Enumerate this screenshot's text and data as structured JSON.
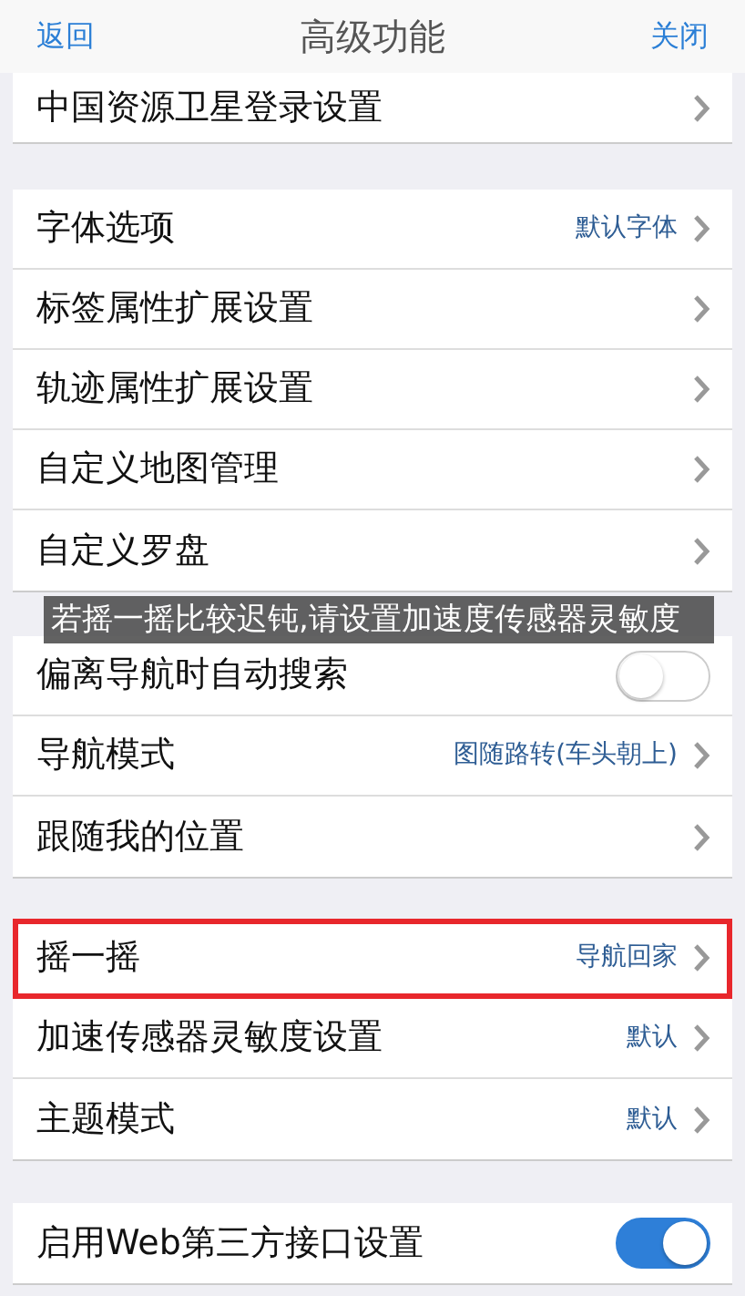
{
  "nav": {
    "back": "返回",
    "title": "高级功能",
    "close": "关闭"
  },
  "groups": [
    {
      "rows": [
        {
          "kind": "link",
          "label": "中国资源卫星登录设置",
          "highlighted": false
        }
      ]
    },
    {
      "rows": [
        {
          "kind": "link",
          "label": "字体选项",
          "value": "默认字体",
          "highlighted": false
        },
        {
          "kind": "link",
          "label": "标签属性扩展设置",
          "highlighted": false
        },
        {
          "kind": "link",
          "label": "轨迹属性扩展设置",
          "highlighted": false
        },
        {
          "kind": "link",
          "label": "自定义地图管理",
          "highlighted": false
        },
        {
          "kind": "link",
          "label": "自定义罗盘",
          "highlighted": false
        }
      ]
    },
    {
      "rows": [
        {
          "kind": "toggle",
          "label": "偏离导航时自动搜索",
          "on": false,
          "highlighted": false
        },
        {
          "kind": "link",
          "label": "导航模式",
          "value": "图随路转(车头朝上)",
          "highlighted": false
        },
        {
          "kind": "link",
          "label": "跟随我的位置",
          "highlighted": false
        }
      ]
    },
    {
      "rows": [
        {
          "kind": "link",
          "label": "摇一摇",
          "value": "导航回家",
          "highlighted": true
        },
        {
          "kind": "link",
          "label": "加速传感器灵敏度设置",
          "value": "默认",
          "highlighted": false
        },
        {
          "kind": "link",
          "label": "主题模式",
          "value": "默认",
          "highlighted": false
        }
      ]
    },
    {
      "rows": [
        {
          "kind": "toggle",
          "label": "启用Web第三方接口设置",
          "on": true,
          "highlighted": false
        }
      ]
    }
  ],
  "toast": "若摇一摇比较迟钝,请设置加速度传感器灵敏度"
}
